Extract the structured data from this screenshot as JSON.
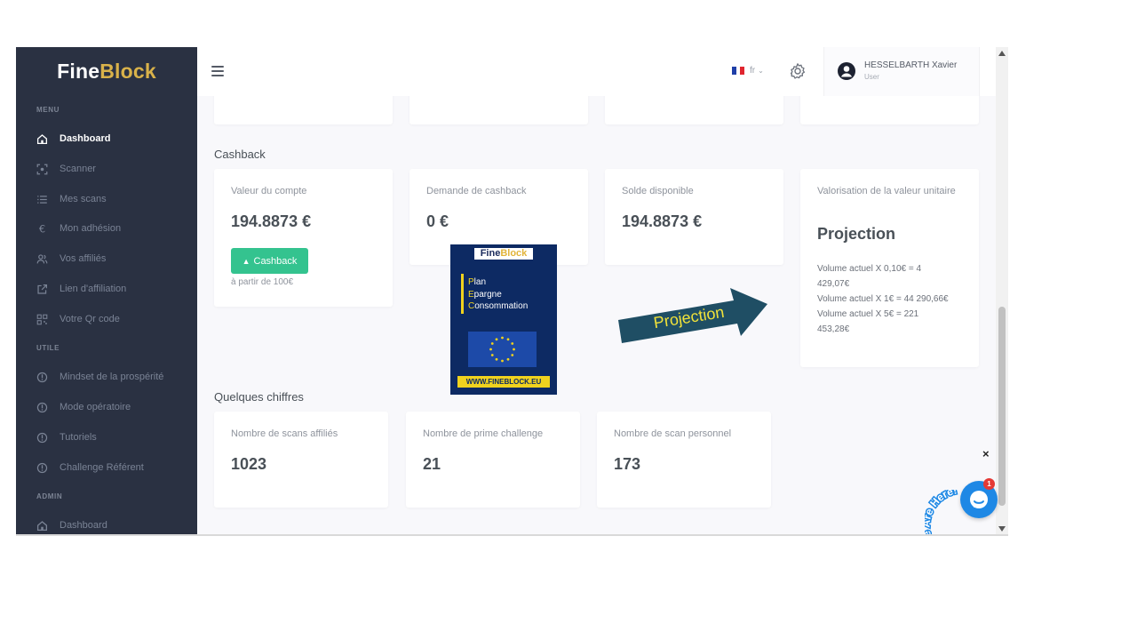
{
  "brand": {
    "name_part1": "Fine",
    "name_part2": "Block",
    "accent": "#d9b24a",
    "sidebar_bg": "#2a3142"
  },
  "sidebar": {
    "menu_title": "MENU",
    "util_title": "UTILE",
    "admin_title": "ADMIN",
    "menu_items": [
      {
        "label": "Dashboard",
        "icon": "home-icon",
        "active": true
      },
      {
        "label": "Scanner",
        "icon": "scan-icon"
      },
      {
        "label": "Mes scans",
        "icon": "list-icon"
      },
      {
        "label": "Mon adhésion",
        "icon": "euro-icon"
      },
      {
        "label": "Vos affiliés",
        "icon": "users-icon"
      },
      {
        "label": "Lien d'affiliation",
        "icon": "external-link-icon"
      },
      {
        "label": "Votre Qr code",
        "icon": "qr-code-icon"
      }
    ],
    "util_items": [
      {
        "label": "Mindset de la prospérité",
        "icon": "info-circle-icon"
      },
      {
        "label": "Mode opératoire",
        "icon": "info-circle-icon"
      },
      {
        "label": "Tutoriels",
        "icon": "info-circle-icon"
      },
      {
        "label": "Challenge Référent",
        "icon": "info-circle-icon"
      }
    ],
    "admin_items": [
      {
        "label": "Dashboard",
        "icon": "home-icon"
      }
    ]
  },
  "topbar": {
    "lang": "fr",
    "user_name": "HESSELBARTH Xavier",
    "user_role": "User"
  },
  "cashback": {
    "title": "Cashback",
    "account_label": "Valeur du compte",
    "account_value": "194.8873 €",
    "button_label": "Cashback",
    "min_note": "à partir de 100€",
    "request_label": "Demande de cashback",
    "request_value": "0 €",
    "balance_label": "Solde disponible",
    "balance_value": "194.8873 €",
    "valuation_label": "Valorisation de la valeur unitaire",
    "projection_title": "Projection",
    "projection_lines": [
      "Volume actuel X 0,10€ = 4 429,07€",
      "Volume actuel X 1€ = 44 290,66€",
      "Volume actuel X 5€ = 221 453,28€"
    ]
  },
  "figures": {
    "title": "Quelques chiffres",
    "cards": [
      {
        "label": "Nombre de scans affiliés",
        "value": "1023"
      },
      {
        "label": "Nombre de prime challenge",
        "value": "21"
      },
      {
        "label": "Nombre de scan personnel",
        "value": "173"
      }
    ]
  },
  "chat": {
    "close": "×",
    "badge": "1",
    "we_are_here": "We Are Here!"
  },
  "poster": {
    "logo_part1": "Fine",
    "logo_part2": "Block",
    "line1_cap": "P",
    "line1_rest": "lan",
    "line2_cap": "E",
    "line2_rest": "pargne",
    "line3_cap": "C",
    "line3_rest": "onsommation",
    "url": "WWW.FINEBLOCK.EU"
  },
  "arrow": {
    "label": "Projection",
    "fill": "#1f4e64",
    "text_color": "#f2e33a"
  }
}
